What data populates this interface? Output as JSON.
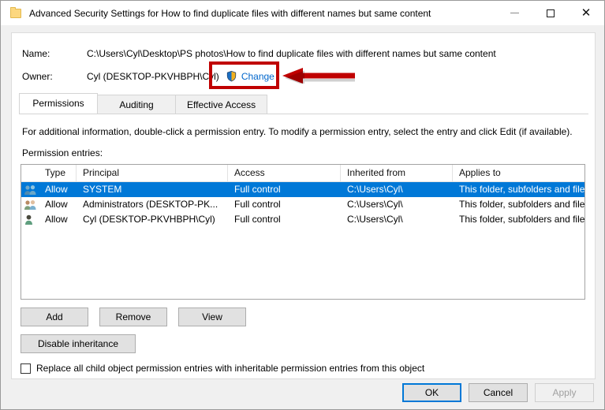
{
  "window": {
    "title": "Advanced Security Settings for How to find duplicate files with different names but same content",
    "icon": "folder-icon",
    "controls": {
      "minimize": "─",
      "maximize": "□",
      "close": "✕"
    }
  },
  "info": {
    "name_label": "Name:",
    "name_value": "C:\\Users\\Cyl\\Desktop\\PS photos\\How to find duplicate files with different names but same content",
    "owner_label": "Owner:",
    "owner_value": "Cyl (DESKTOP-PKVHBPH\\Cyl)",
    "change_link": "Change",
    "change_icon": "uac-shield-icon"
  },
  "tabs": [
    {
      "label": "Permissions",
      "selected": true
    },
    {
      "label": "Auditing",
      "selected": false
    },
    {
      "label": "Effective Access",
      "selected": false
    }
  ],
  "main": {
    "description": "For additional information, double-click a permission entry. To modify a permission entry, select the entry and click Edit (if available).",
    "entries_label": "Permission entries:"
  },
  "table": {
    "columns": [
      "Type",
      "Principal",
      "Access",
      "Inherited from",
      "Applies to"
    ],
    "rows": [
      {
        "icon": "group-icon",
        "type": "Allow",
        "principal": "SYSTEM",
        "access": "Full control",
        "inherited_from": "C:\\Users\\Cyl\\",
        "applies_to": "This folder, subfolders and files",
        "selected": true
      },
      {
        "icon": "group-icon",
        "type": "Allow",
        "principal": "Administrators (DESKTOP-PK...",
        "access": "Full control",
        "inherited_from": "C:\\Users\\Cyl\\",
        "applies_to": "This folder, subfolders and files",
        "selected": false
      },
      {
        "icon": "user-icon",
        "type": "Allow",
        "principal": "Cyl (DESKTOP-PKVHBPH\\Cyl)",
        "access": "Full control",
        "inherited_from": "C:\\Users\\Cyl\\",
        "applies_to": "This folder, subfolders and files",
        "selected": false
      }
    ]
  },
  "actions": {
    "add": "Add",
    "remove": "Remove",
    "view": "View",
    "disable_inheritance": "Disable inheritance"
  },
  "checkbox": {
    "label": "Replace all child object permission entries with inheritable permission entries from this object",
    "checked": false
  },
  "footer": {
    "ok": "OK",
    "cancel": "Cancel",
    "apply": "Apply",
    "apply_disabled": true
  },
  "annotation": {
    "color": "#c00000",
    "shape": "highlight-box-with-left-arrow",
    "target": "Change"
  },
  "colors": {
    "selection": "#0078d7",
    "link": "#0066cc",
    "annotation": "#c00000",
    "window_bg": "#f0f0f0"
  }
}
